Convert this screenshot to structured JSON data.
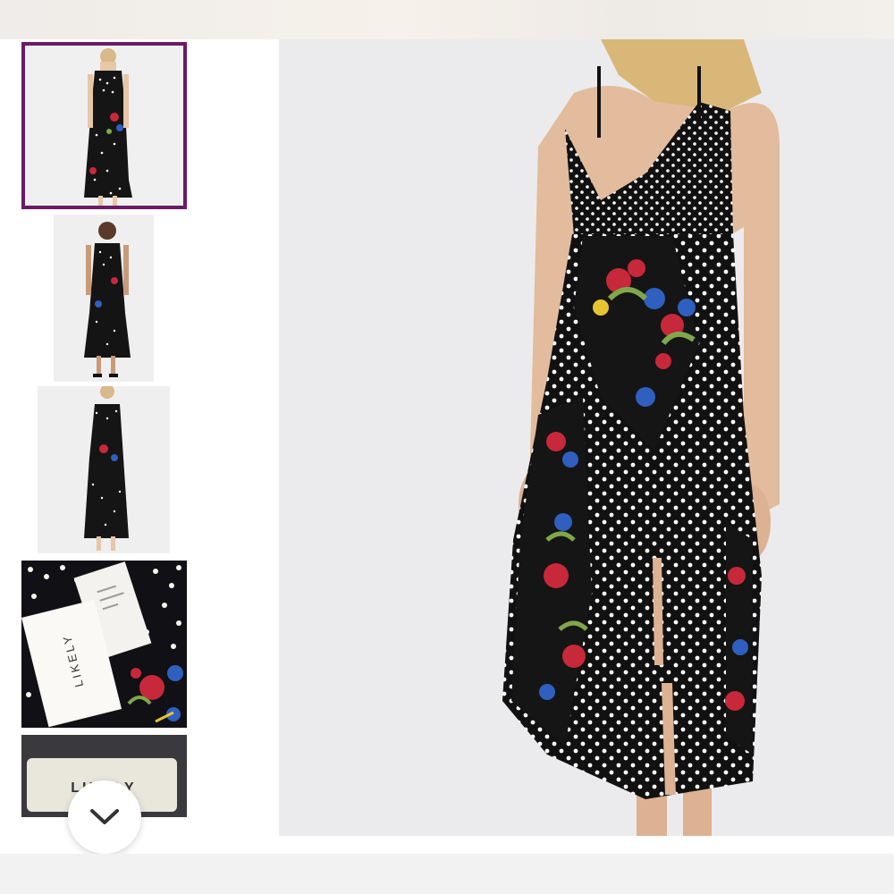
{
  "gallery": {
    "thumbnails": [
      {
        "name": "thumb-model-front",
        "selected": true
      },
      {
        "name": "thumb-model-full-body",
        "selected": false
      },
      {
        "name": "thumb-model-back",
        "selected": false
      },
      {
        "name": "thumb-tags-closeup",
        "selected": false
      },
      {
        "name": "thumb-brand-label",
        "selected": false
      }
    ],
    "hang_tag_text": "LIKELY",
    "neck_label_text": "LIKELY",
    "scroll_icon": "chevron-down-icon",
    "selected_border_color": "#6b1a66"
  },
  "main_image": {
    "description_icon": "product-photo",
    "dress_colors": {
      "base": "#111111",
      "dot": "#ffffff",
      "flower_red": "#c7283a",
      "flower_blue": "#2f5fbf",
      "leaf": "#7fa84a"
    }
  }
}
